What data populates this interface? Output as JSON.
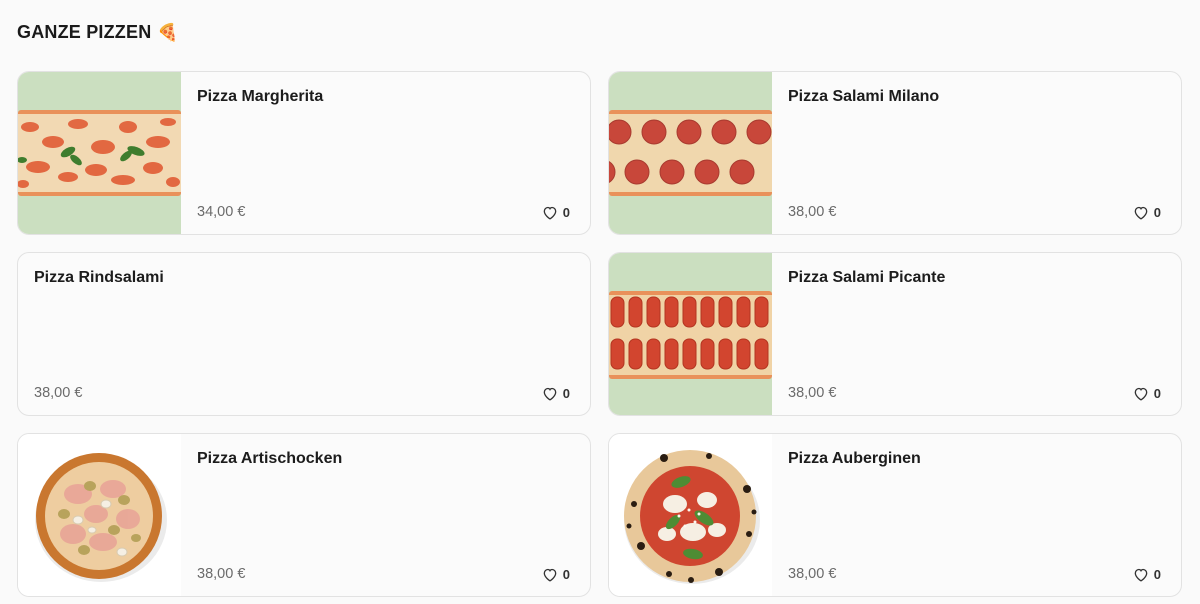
{
  "section": {
    "title": "GANZE PIZZEN",
    "emoji": "🍕"
  },
  "products": [
    {
      "name": "Pizza Margherita",
      "price": "34,00 €",
      "likes": "0",
      "image": "margherita-strip",
      "image_bg": "#cbdfc0"
    },
    {
      "name": "Pizza Salami Milano",
      "price": "38,00 €",
      "likes": "0",
      "image": "salami-strip",
      "image_bg": "#cbdfc0"
    },
    {
      "name": "Pizza Rindsalami",
      "price": "38,00 €",
      "likes": "0",
      "image": "none"
    },
    {
      "name": "Pizza Salami Picante",
      "price": "38,00 €",
      "likes": "0",
      "image": "picante-strip",
      "image_bg": "#cbdfc0"
    },
    {
      "name": "Pizza Artischocken",
      "price": "38,00 €",
      "likes": "0",
      "image": "artichoke-round",
      "image_bg": "#ffffff"
    },
    {
      "name": "Pizza Auberginen",
      "price": "38,00 €",
      "likes": "0",
      "image": "aubergine-round",
      "image_bg": "#ffffff"
    }
  ],
  "colors": {
    "thumb_green": "#cbdfc0",
    "card_border": "#e2e2e2",
    "price_text": "#6b6b6b"
  }
}
